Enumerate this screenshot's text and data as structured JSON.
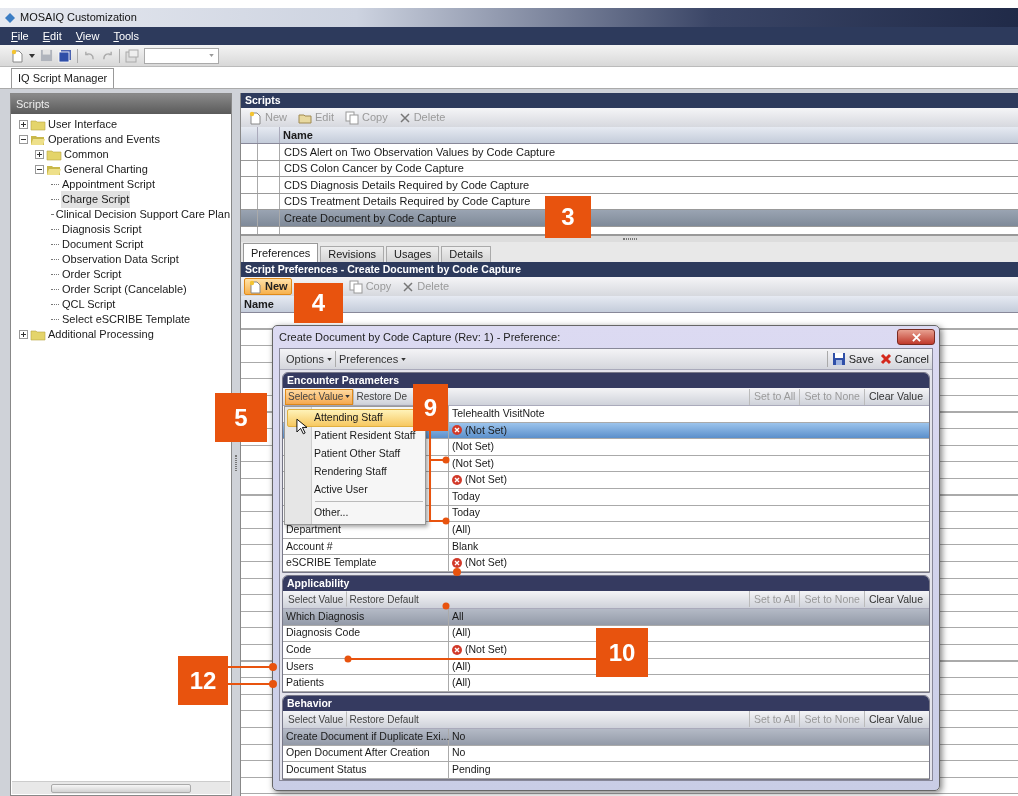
{
  "window": {
    "title": "MOSAIQ Customization"
  },
  "menu_bar": [
    "File",
    "Edit",
    "View",
    "Tools"
  ],
  "app_tabs": [
    {
      "label": "IQ Script Manager",
      "selected": true
    }
  ],
  "sidebar": {
    "title": "Scripts",
    "tree": [
      {
        "label": "User Interface",
        "kind": "folder",
        "expanded": false,
        "selected": false
      },
      {
        "label": "Operations and Events",
        "kind": "folder",
        "expanded": true,
        "selected": false,
        "children": [
          {
            "label": "Common",
            "kind": "folder",
            "expanded": false,
            "selected": false
          },
          {
            "label": "General Charting",
            "kind": "folder",
            "expanded": true,
            "selected": false,
            "children": [
              {
                "label": "Appointment Script",
                "kind": "script",
                "selected": false
              },
              {
                "label": "Charge Script",
                "kind": "script",
                "selected": true
              },
              {
                "label": "Clinical Decision Support Care Plan",
                "kind": "script",
                "selected": false
              },
              {
                "label": "Diagnosis Script",
                "kind": "script",
                "selected": false
              },
              {
                "label": "Document Script",
                "kind": "script",
                "selected": false
              },
              {
                "label": "Observation Data Script",
                "kind": "script",
                "selected": false
              },
              {
                "label": "Order Script",
                "kind": "script",
                "selected": false
              },
              {
                "label": "Order Script (Cancelable)",
                "kind": "script",
                "selected": false
              },
              {
                "label": "QCL Script",
                "kind": "script",
                "selected": false
              },
              {
                "label": "Select eSCRIBE Template",
                "kind": "script",
                "selected": false
              }
            ]
          }
        ]
      },
      {
        "label": "Additional Processing",
        "kind": "folder",
        "expanded": false,
        "selected": false
      }
    ]
  },
  "scripts_panel": {
    "title": "Scripts",
    "toolbar": [
      {
        "label": "New",
        "kind": "new",
        "disabled": true,
        "highlighted": false
      },
      {
        "label": "Edit",
        "kind": "edit",
        "disabled": true,
        "highlighted": false
      },
      {
        "label": "Copy",
        "kind": "copy",
        "disabled": true,
        "highlighted": false
      },
      {
        "label": "Delete",
        "kind": "delete",
        "disabled": true,
        "highlighted": false
      }
    ],
    "columns": [
      "Name"
    ],
    "rows": [
      {
        "name": "CDS Alert on Two Observation Values by Code Capture",
        "selected": false
      },
      {
        "name": "CDS Colon Cancer by Code Capture",
        "selected": false
      },
      {
        "name": "CDS Diagnosis Details Required by Code Capture",
        "selected": false
      },
      {
        "name": "CDS Treatment Details Required by Code Capture",
        "selected": false
      },
      {
        "name": "Create Document by Code Capture",
        "selected": true
      }
    ]
  },
  "detail_tabs": [
    {
      "label": "Preferences",
      "selected": true
    },
    {
      "label": "Revisions",
      "selected": false
    },
    {
      "label": "Usages",
      "selected": false
    },
    {
      "label": "Details",
      "selected": false
    }
  ],
  "script_preferences": {
    "title": "Script Preferences - Create Document by Code Capture",
    "toolbar": [
      {
        "label": "New",
        "kind": "new",
        "disabled": false,
        "highlighted": true
      },
      {
        "label": "Copy",
        "kind": "copy",
        "disabled": true,
        "highlighted": false
      },
      {
        "label": "Delete",
        "kind": "delete",
        "disabled": true,
        "highlighted": false
      }
    ],
    "columns": [
      "Name"
    ]
  },
  "dialog": {
    "title": "Create Document by Code Capture (Rev: 1) - Preference:",
    "menus": [
      "Options",
      "Preferences"
    ],
    "actions": [
      {
        "label": "Save",
        "kind": "save"
      },
      {
        "label": "Cancel",
        "kind": "cancel"
      }
    ],
    "sections": [
      {
        "title": "Encounter Parameters",
        "focused": true,
        "left_tools": [
          {
            "label": "Select Value",
            "dropdown": true,
            "highlighted": true,
            "disabled": false
          },
          {
            "label": "Restore De",
            "dropdown": false,
            "highlighted": false,
            "disabled": false
          }
        ],
        "right_tools": [
          {
            "label": "Set to All",
            "disabled": true
          },
          {
            "label": "Set to None",
            "disabled": true
          },
          {
            "label": "Clear Value",
            "disabled": false
          }
        ],
        "rows": [
          {
            "value": "Telehealth VisitNote",
            "error": false,
            "selected": false
          },
          {
            "value": "(Not Set)",
            "error": true,
            "selected": true
          },
          {
            "value": "(Not Set)",
            "error": false,
            "selected": false
          },
          {
            "value": "(Not Set)",
            "error": false,
            "selected": false
          },
          {
            "value": "(Not Set)",
            "error": true,
            "selected": false
          },
          {
            "value": "Today",
            "error": false,
            "selected": false
          },
          {
            "value": "Today",
            "error": false,
            "selected": false
          },
          {
            "label": "Department",
            "value": "(All)",
            "error": false,
            "selected": false
          },
          {
            "label": "Account #",
            "value": "Blank",
            "error": false,
            "selected": false
          },
          {
            "label": "eSCRIBE Template",
            "value": "(Not Set)",
            "error": true,
            "selected": false
          }
        ]
      },
      {
        "title": "Applicability",
        "focused": false,
        "left_tools": [
          {
            "label": "Select Value",
            "dropdown": false,
            "highlighted": false,
            "disabled": false
          },
          {
            "label": "Restore Default",
            "dropdown": false,
            "highlighted": false,
            "disabled": false
          }
        ],
        "right_tools": [
          {
            "label": "Set to All",
            "disabled": true
          },
          {
            "label": "Set to None",
            "disabled": true
          },
          {
            "label": "Clear Value",
            "disabled": false
          }
        ],
        "rows": [
          {
            "label": "Which Diagnosis",
            "value": "All",
            "error": false,
            "selected": true
          },
          {
            "label": "Diagnosis Code",
            "value": "(All)",
            "error": false,
            "selected": false
          },
          {
            "label": "Code",
            "value": "(Not Set)",
            "error": true,
            "selected": false
          },
          {
            "label": "Users",
            "value": "(All)",
            "error": false,
            "selected": false
          },
          {
            "label": "Patients",
            "value": "(All)",
            "error": false,
            "selected": false
          }
        ]
      },
      {
        "title": "Behavior",
        "focused": false,
        "left_tools": [
          {
            "label": "Select Value",
            "dropdown": false,
            "highlighted": false,
            "disabled": false
          },
          {
            "label": "Restore Default",
            "dropdown": false,
            "highlighted": false,
            "disabled": false
          }
        ],
        "right_tools": [
          {
            "label": "Set to All",
            "disabled": true
          },
          {
            "label": "Set to None",
            "disabled": true
          },
          {
            "label": "Clear Value",
            "disabled": false
          }
        ],
        "rows": [
          {
            "label": "Create Document if Duplicate Exi...",
            "value": "No",
            "error": false,
            "selected": true
          },
          {
            "label": "Open Document After Creation",
            "value": "No",
            "error": false,
            "selected": false
          },
          {
            "label": "Document Status",
            "value": "Pending",
            "error": false,
            "selected": false
          }
        ]
      }
    ]
  },
  "dropdown_menu": [
    {
      "kind": "item",
      "label": "Attending Staff",
      "selected": true
    },
    {
      "kind": "item",
      "label": "Patient Resident Staff",
      "selected": false
    },
    {
      "kind": "item",
      "label": "Patient Other Staff",
      "selected": false
    },
    {
      "kind": "item",
      "label": "Rendering Staff",
      "selected": false
    },
    {
      "kind": "item",
      "label": "Active User",
      "selected": false
    },
    {
      "kind": "separator"
    },
    {
      "kind": "item",
      "label": "Other...",
      "selected": false
    }
  ],
  "callouts": [
    "3",
    "4",
    "5",
    "9",
    "10",
    "12"
  ]
}
